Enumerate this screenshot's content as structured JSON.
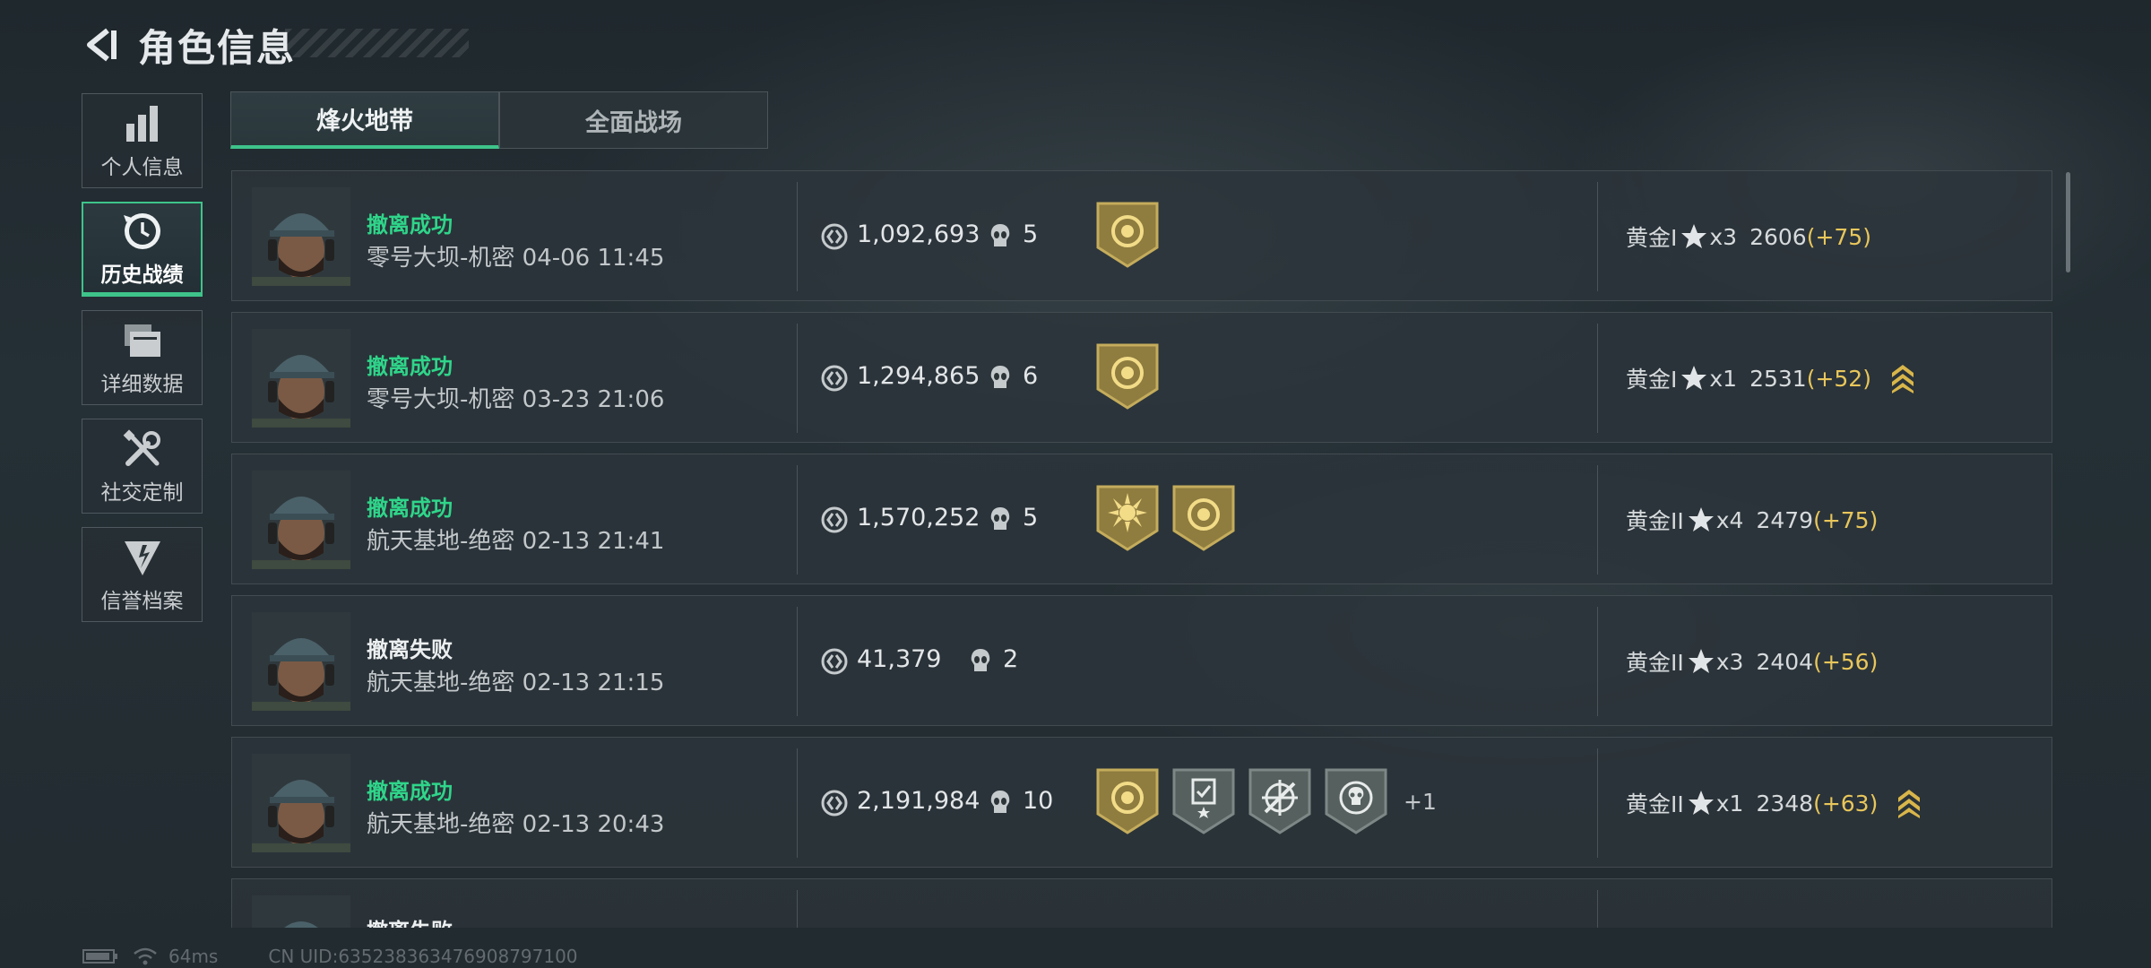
{
  "header": {
    "title": "角色信息",
    "back_icon": "back-arrow-icon"
  },
  "sidebar": {
    "items": [
      {
        "label": "个人信息",
        "icon": "bar-chart-icon",
        "active": false
      },
      {
        "label": "历史战绩",
        "icon": "history-clock-icon",
        "active": true
      },
      {
        "label": "详细数据",
        "icon": "folder-icon",
        "active": false
      },
      {
        "label": "社交定制",
        "icon": "tools-icon",
        "active": false
      },
      {
        "label": "信誉档案",
        "icon": "credit-badge-icon",
        "active": false
      }
    ]
  },
  "tabs": [
    {
      "label": "烽火地带",
      "active": true
    },
    {
      "label": "全面战场",
      "active": false
    }
  ],
  "records": [
    {
      "status": "撤离成功",
      "status_type": "success",
      "map": "零号大坝-机密",
      "time": "04-06 11:45",
      "money": "1,092,693",
      "kills": "5",
      "badges": [
        "gold-shield-badge"
      ],
      "more": "",
      "rank": "黄金I",
      "stars": "x3",
      "score": "2606",
      "delta": "(+75)",
      "promo": false
    },
    {
      "status": "撤离成功",
      "status_type": "success",
      "map": "零号大坝-机密",
      "time": "03-23 21:06",
      "money": "1,294,865",
      "kills": "6",
      "badges": [
        "gold-shield-badge"
      ],
      "more": "",
      "rank": "黄金I",
      "stars": "x1",
      "score": "2531",
      "delta": "(+52)",
      "promo": true
    },
    {
      "status": "撤离成功",
      "status_type": "success",
      "map": "航天基地-绝密",
      "time": "02-13 21:41",
      "money": "1,570,252",
      "kills": "5",
      "badges": [
        "gold-sun-badge",
        "gold-shield-badge"
      ],
      "more": "",
      "rank": "黄金II",
      "stars": "x4",
      "score": "2479",
      "delta": "(+75)",
      "promo": false
    },
    {
      "status": "撤离失败",
      "status_type": "fail",
      "map": "航天基地-绝密",
      "time": "02-13 21:15",
      "money": "41,379",
      "kills": "2",
      "badges": [],
      "more": "",
      "rank": "黄金II",
      "stars": "x3",
      "score": "2404",
      "delta": "(+56)",
      "promo": false
    },
    {
      "status": "撤离成功",
      "status_type": "success",
      "map": "航天基地-绝密",
      "time": "02-13 20:43",
      "money": "2,191,984",
      "kills": "10",
      "badges": [
        "gold-shield-badge",
        "gray-clipboard-badge",
        "gray-crosshair-badge",
        "gray-skull-badge"
      ],
      "more": "+1",
      "rank": "黄金II",
      "stars": "x1",
      "score": "2348",
      "delta": "(+63)",
      "promo": true
    },
    {
      "status": "撤离失败",
      "status_type": "fail",
      "map": "",
      "time": "",
      "money": "",
      "kills": "",
      "badges": [],
      "more": "",
      "rank": "",
      "stars": "",
      "score": "",
      "delta": "",
      "promo": false
    }
  ],
  "footer": {
    "ping": "64ms",
    "uid": "CN UID:635238363476908797100"
  },
  "colors": {
    "accent": "#3ec48a",
    "success": "#2fd58a",
    "delta": "#e8c65b"
  }
}
